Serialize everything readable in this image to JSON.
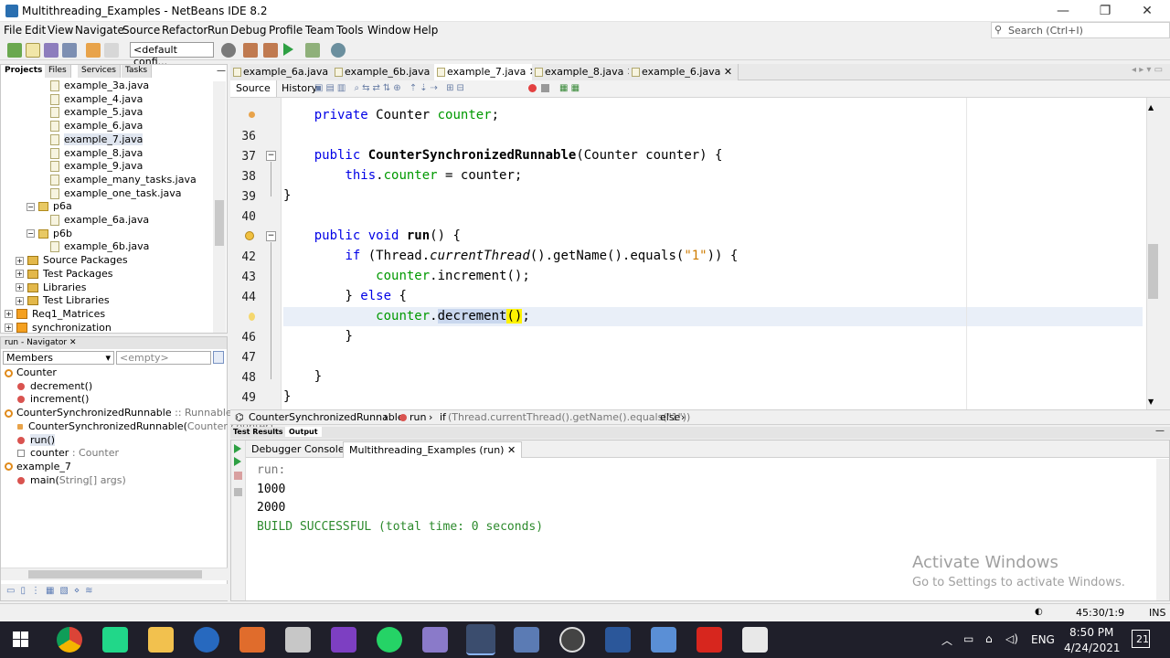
{
  "window": {
    "title": "Multithreading_Examples - NetBeans IDE 8.2",
    "controls": [
      "—",
      "❐",
      "✕"
    ]
  },
  "menu": [
    "File",
    "Edit",
    "View",
    "Navigate",
    "Source",
    "Refactor",
    "Run",
    "Debug",
    "Profile",
    "Team",
    "Tools",
    "Window",
    "Help"
  ],
  "search": {
    "placeholder": "Search (Ctrl+I)"
  },
  "toolbar": {
    "config": "<default confi..."
  },
  "projects_panel": {
    "tabs": [
      "Projects",
      "Files",
      "Services",
      "Tasks"
    ],
    "items": [
      {
        "label": "example_3a.java",
        "kind": "file",
        "indent": 2
      },
      {
        "label": "example_4.java",
        "kind": "file",
        "indent": 2
      },
      {
        "label": "example_5.java",
        "kind": "file",
        "indent": 2
      },
      {
        "label": "example_6.java",
        "kind": "file",
        "indent": 2
      },
      {
        "label": "example_7.java",
        "kind": "file",
        "indent": 2,
        "selected": true
      },
      {
        "label": "example_8.java",
        "kind": "file",
        "indent": 2
      },
      {
        "label": "example_9.java",
        "kind": "file",
        "indent": 2
      },
      {
        "label": "example_many_tasks.java",
        "kind": "file",
        "indent": 2
      },
      {
        "label": "example_one_task.java",
        "kind": "file",
        "indent": 2
      },
      {
        "label": "p6a",
        "kind": "package",
        "indent": 1
      },
      {
        "label": "example_6a.java",
        "kind": "file",
        "indent": 2
      },
      {
        "label": "p6b",
        "kind": "package",
        "indent": 1
      },
      {
        "label": "example_6b.java",
        "kind": "file",
        "indent": 2
      },
      {
        "label": "Source Packages",
        "kind": "folder",
        "indent": 0
      },
      {
        "label": "Test Packages",
        "kind": "folder",
        "indent": 0
      },
      {
        "label": "Libraries",
        "kind": "folder",
        "indent": 0
      },
      {
        "label": "Test Libraries",
        "kind": "folder",
        "indent": 0
      },
      {
        "label": "Req1_Matrices",
        "kind": "project",
        "indent": -1
      },
      {
        "label": "synchronization",
        "kind": "project",
        "indent": -1
      }
    ]
  },
  "navigator": {
    "title": "run - Navigator",
    "members_label": "Members",
    "filter_placeholder": "<empty>",
    "items": [
      {
        "label": "Counter",
        "kind": "class",
        "indent": 0
      },
      {
        "label": "decrement()",
        "kind": "method",
        "indent": 1
      },
      {
        "label": "increment()",
        "kind": "method",
        "indent": 1
      },
      {
        "label": "CounterSynchronizedRunnable",
        "suffix": " :: Runnable",
        "kind": "class",
        "indent": 0
      },
      {
        "label": "CounterSynchronizedRunnable(",
        "suffix": "Counter counter)",
        "kind": "ctor",
        "indent": 1
      },
      {
        "label": "run()",
        "kind": "method",
        "indent": 1,
        "selected": true
      },
      {
        "label": "counter",
        "suffix": " : Counter",
        "kind": "field",
        "indent": 1
      },
      {
        "label": "example_7",
        "kind": "class",
        "indent": 0
      },
      {
        "label": "main(",
        "suffix": "String[] args)",
        "kind": "method",
        "indent": 1
      }
    ]
  },
  "editor_tabs": [
    {
      "label": "example_6a.java"
    },
    {
      "label": "example_6b.java"
    },
    {
      "label": "example_7.java",
      "active": true
    },
    {
      "label": "example_8.java"
    },
    {
      "label": "example_6.java"
    }
  ],
  "editor_subtabs": {
    "source": "Source",
    "history": "History"
  },
  "code": {
    "line_numbers": [
      "",
      "36",
      "37",
      "38",
      "39",
      "40",
      "",
      "42",
      "43",
      "44",
      "",
      "46",
      "47",
      "48",
      "49"
    ],
    "l35a": "private",
    "l35b": "Counter",
    "l35c": "counter",
    "l35d": ";",
    "l37a": "public",
    "l37b": "CounterSynchronizedRunnable",
    "l37c": "(Counter counter) {",
    "l38a": "this",
    "l38b": ".",
    "l38c": "counter",
    "l38d": " = counter;",
    "l39": "}",
    "l41a": "public void",
    "l41b": "run",
    "l41c": "() {",
    "l42a": "if",
    "l42b": "(Thread.",
    "l42c": "currentThread",
    "l42d": "().getName().equals(",
    "l42e": "\"1\"",
    "l42f": ")) {",
    "l43a": "counter",
    "l43b": ".increment();",
    "l44a": "} ",
    "l44b": "else",
    "l44c": " {",
    "l45a": "counter",
    "l45b": ".",
    "l45c": "decrement",
    "l45d": "()",
    "l45e": ";",
    "l46": "}",
    "l48": "}",
    "l49": "}"
  },
  "breadcrumb": {
    "c1": "CounterSynchronizedRunnable",
    "c2": "run",
    "c3a": "if",
    "c3b": "(Thread.currentThread().getName().equals(\"1\"))",
    "c3c": "else"
  },
  "output": {
    "panel_tabs": [
      "Test Results",
      "Output"
    ],
    "sub_tabs": [
      "Debugger Console",
      "Multithreading_Examples (run)"
    ],
    "lines": [
      "run:",
      "1000",
      "2000",
      "BUILD SUCCESSFUL (total time: 0 seconds)"
    ]
  },
  "activate": {
    "title": "Activate Windows",
    "sub": "Go to Settings to activate Windows."
  },
  "status": {
    "position": "45:30/1:9",
    "mode": "INS"
  },
  "taskbar": {
    "lang": "ENG",
    "time": "8:50 PM",
    "date": "4/24/2021",
    "notif": "21"
  }
}
